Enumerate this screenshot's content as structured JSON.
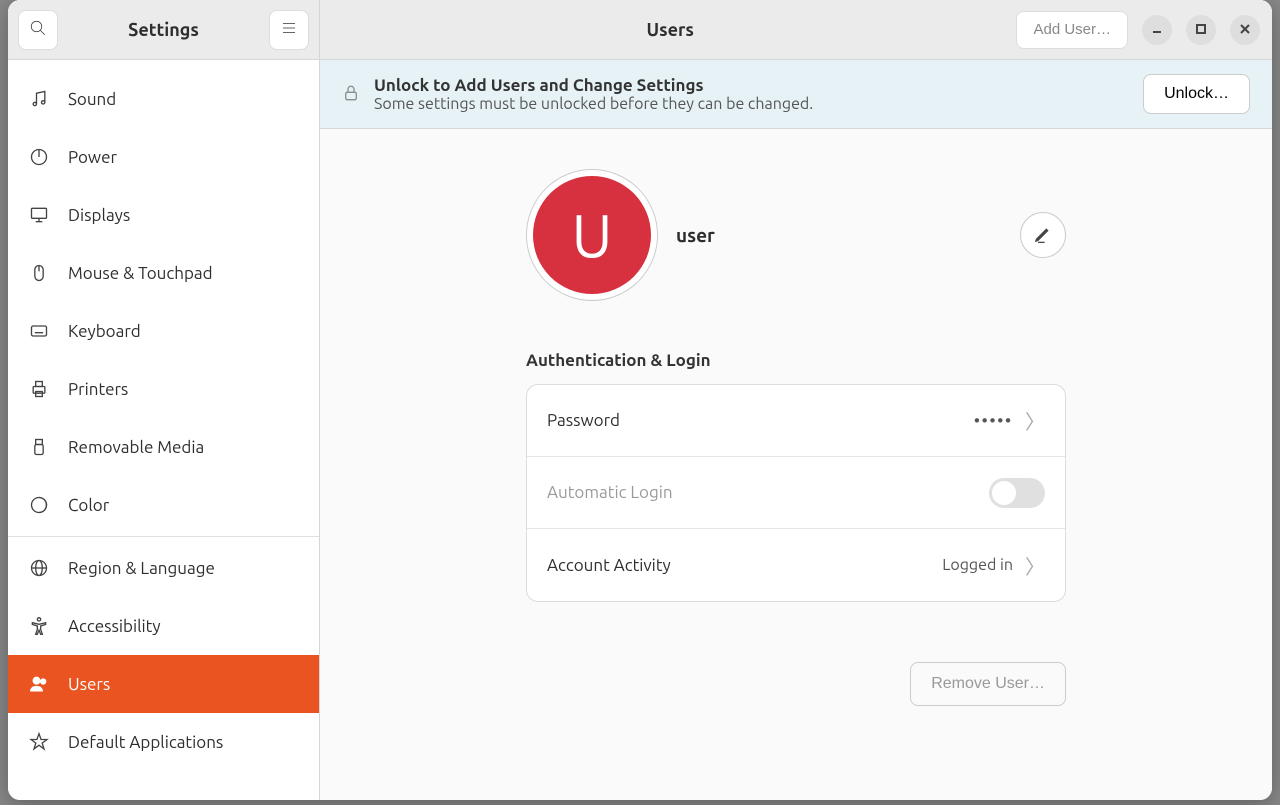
{
  "sidebar": {
    "title": "Settings",
    "items": [
      {
        "label": "Sound",
        "icon": "music-note-icon"
      },
      {
        "label": "Power",
        "icon": "power-icon"
      },
      {
        "label": "Displays",
        "icon": "display-icon"
      },
      {
        "label": "Mouse & Touchpad",
        "icon": "mouse-icon"
      },
      {
        "label": "Keyboard",
        "icon": "keyboard-icon"
      },
      {
        "label": "Printers",
        "icon": "printer-icon"
      },
      {
        "label": "Removable Media",
        "icon": "usb-icon"
      },
      {
        "label": "Color",
        "icon": "color-icon"
      },
      {
        "label": "Region & Language",
        "icon": "globe-icon"
      },
      {
        "label": "Accessibility",
        "icon": "accessibility-icon"
      },
      {
        "label": "Users",
        "icon": "users-icon",
        "selected": true
      },
      {
        "label": "Default Applications",
        "icon": "star-icon"
      }
    ]
  },
  "header": {
    "title": "Users",
    "add_user": "Add User…"
  },
  "banner": {
    "title": "Unlock to Add Users and Change Settings",
    "subtitle": "Some settings must be unlocked before they can be changed.",
    "button": "Unlock…"
  },
  "profile": {
    "initial": "U",
    "name": "user"
  },
  "auth": {
    "section_title": "Authentication & Login",
    "password_label": "Password",
    "password_value": "•••••",
    "auto_login_label": "Automatic Login",
    "auto_login_on": false,
    "activity_label": "Account Activity",
    "activity_value": "Logged in"
  },
  "footer": {
    "remove": "Remove User…"
  }
}
